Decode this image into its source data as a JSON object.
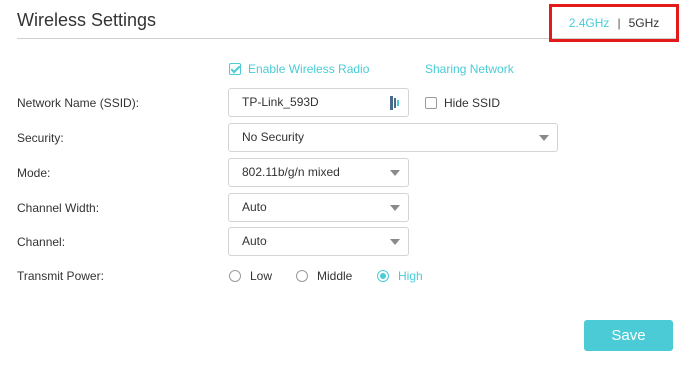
{
  "header": {
    "title": "Wireless Settings",
    "band_24": "2.4GHz",
    "band_separator": "|",
    "band_5": "5GHz"
  },
  "options": {
    "enable_radio_label": "Enable Wireless Radio",
    "enable_radio_checked": true,
    "sharing_network_label": "Sharing Network"
  },
  "fields": {
    "ssid": {
      "label": "Network Name (SSID):",
      "value": "TP-Link_593D"
    },
    "hide_ssid": {
      "label": "Hide SSID",
      "checked": false
    },
    "security": {
      "label": "Security:",
      "value": "No Security"
    },
    "mode": {
      "label": "Mode:",
      "value": "802.11b/g/n mixed"
    },
    "channel_width": {
      "label": "Channel Width:",
      "value": "Auto"
    },
    "channel": {
      "label": "Channel:",
      "value": "Auto"
    },
    "transmit_power": {
      "label": "Transmit Power:",
      "options": [
        "Low",
        "Middle",
        "High"
      ],
      "selected": "High"
    }
  },
  "actions": {
    "save_label": "Save"
  },
  "colors": {
    "accent": "#4acbd6",
    "highlight_box": "#e31a1a"
  }
}
